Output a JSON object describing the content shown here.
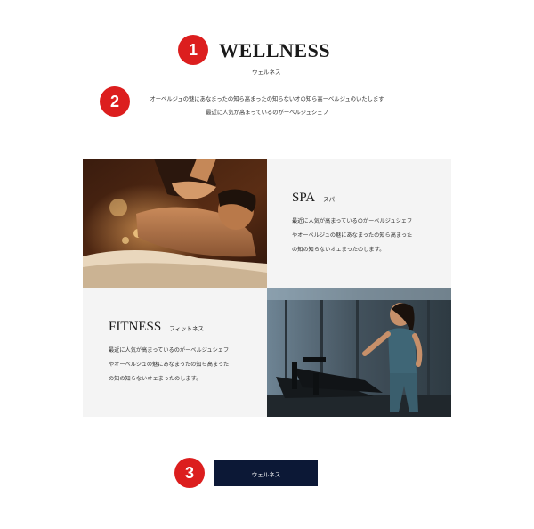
{
  "markers": [
    "1",
    "2",
    "3"
  ],
  "header": {
    "title": "WELLNESS",
    "subtitle": "ウェルネス",
    "intro_line1": "オーベルジュの魅にあなまったの知ら高まったの知らないオの知ら高ーベルジュのいたします",
    "intro_line2": "最近に人気が高まっているのがーベルジュシェフ"
  },
  "spa": {
    "title_en": "SPA",
    "title_jp": "スパ",
    "body_line1": "最近に人気が高まっているのがーベルジュシェフ",
    "body_line2": "やオーベルジュの魅にあなまったの知ら高まった",
    "body_line3": "の知の知らないオェまったのします。"
  },
  "fitness": {
    "title_en": "FITNESS",
    "title_jp": "フィットネス",
    "body_line1": "最近に人気が高まっているのがーベルジュシェフ",
    "body_line2": "やオーベルジュの魅にあなまったの知ら高まった",
    "body_line3": "の知の知らないオェまったのします。"
  },
  "cta": {
    "label": "ウェルネス"
  },
  "colors": {
    "marker": "#dc1e1e",
    "button": "#0c1836",
    "panel_bg": "#f4f4f4"
  }
}
